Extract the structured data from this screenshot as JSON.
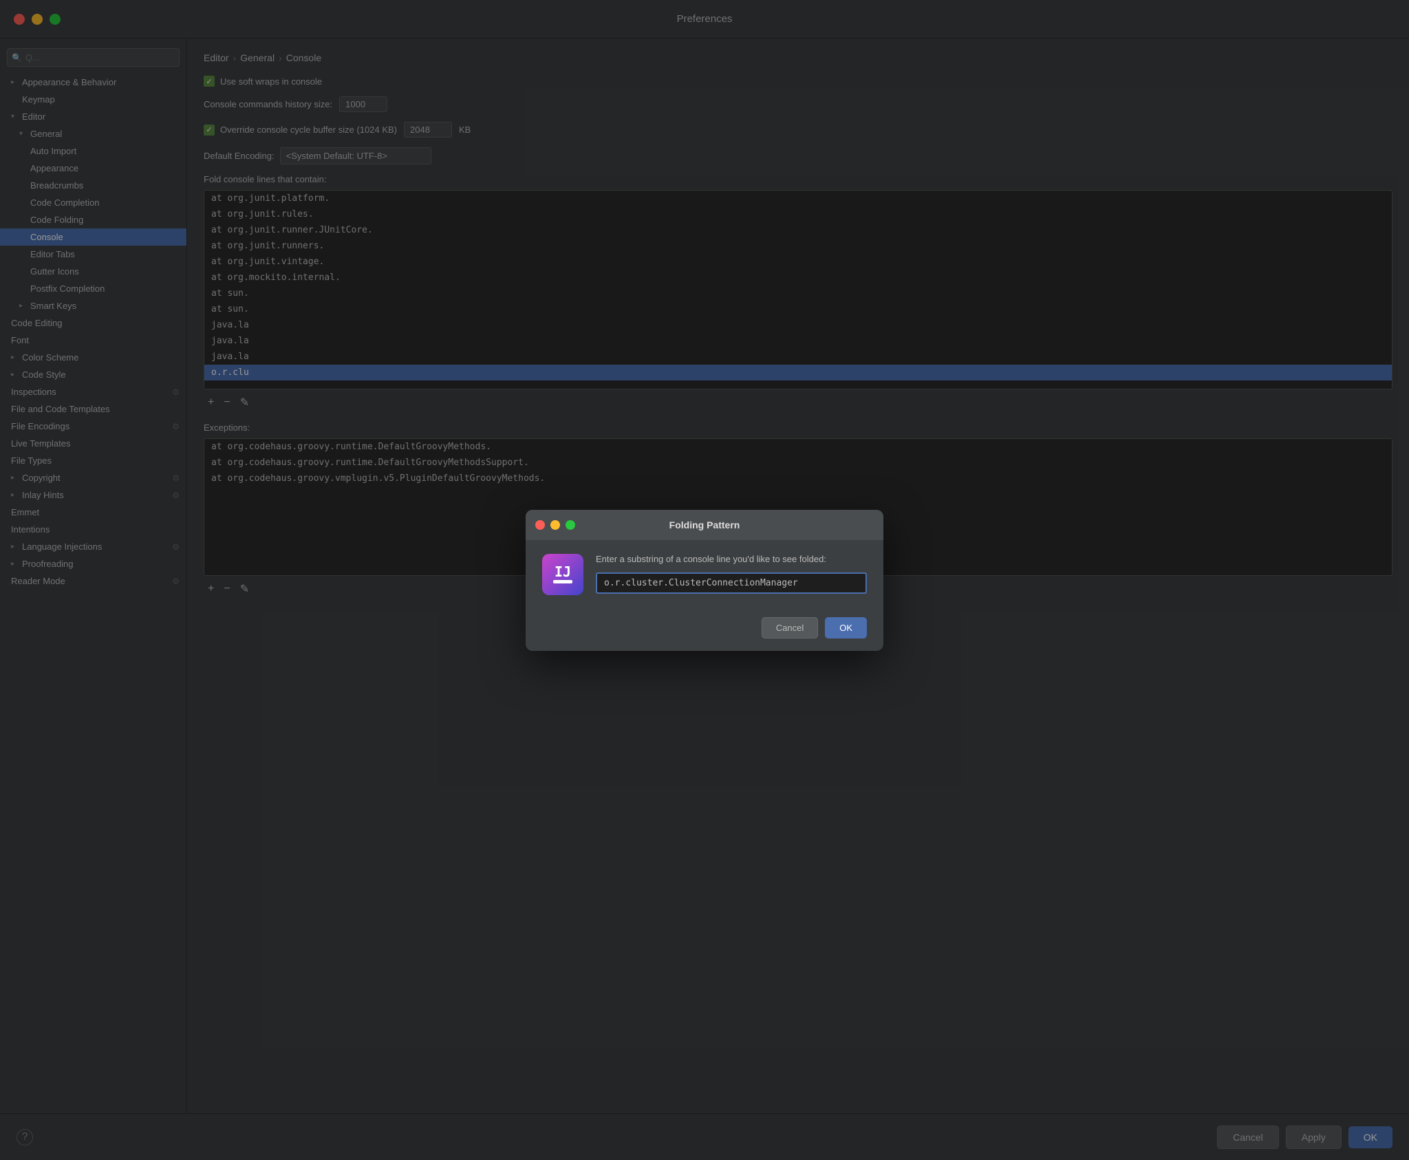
{
  "window": {
    "title": "Preferences"
  },
  "sidebar": {
    "search_placeholder": "Q...",
    "items": [
      {
        "id": "appearance-behavior",
        "label": "Appearance & Behavior",
        "indent": 0,
        "type": "collapsed-parent"
      },
      {
        "id": "keymap",
        "label": "Keymap",
        "indent": 0,
        "type": "item"
      },
      {
        "id": "editor",
        "label": "Editor",
        "indent": 0,
        "type": "expanded-parent"
      },
      {
        "id": "general",
        "label": "General",
        "indent": 1,
        "type": "expanded-parent"
      },
      {
        "id": "auto-import",
        "label": "Auto Import",
        "indent": 2,
        "type": "item"
      },
      {
        "id": "appearance",
        "label": "Appearance",
        "indent": 2,
        "type": "item"
      },
      {
        "id": "breadcrumbs",
        "label": "Breadcrumbs",
        "indent": 2,
        "type": "item"
      },
      {
        "id": "code-completion",
        "label": "Code Completion",
        "indent": 2,
        "type": "item"
      },
      {
        "id": "code-folding",
        "label": "Code Folding",
        "indent": 2,
        "type": "item"
      },
      {
        "id": "console",
        "label": "Console",
        "indent": 2,
        "type": "item",
        "active": true
      },
      {
        "id": "editor-tabs",
        "label": "Editor Tabs",
        "indent": 2,
        "type": "item"
      },
      {
        "id": "gutter-icons",
        "label": "Gutter Icons",
        "indent": 2,
        "type": "item"
      },
      {
        "id": "postfix-completion",
        "label": "Postfix Completion",
        "indent": 2,
        "type": "item"
      },
      {
        "id": "smart-keys",
        "label": "Smart Keys",
        "indent": 1,
        "type": "collapsed-parent"
      },
      {
        "id": "code-editing",
        "label": "Code Editing",
        "indent": 0,
        "type": "item"
      },
      {
        "id": "font",
        "label": "Font",
        "indent": 0,
        "type": "item"
      },
      {
        "id": "color-scheme",
        "label": "Color Scheme",
        "indent": 0,
        "type": "collapsed-parent"
      },
      {
        "id": "code-style",
        "label": "Code Style",
        "indent": 0,
        "type": "collapsed-parent"
      },
      {
        "id": "inspections",
        "label": "Inspections",
        "indent": 0,
        "type": "item",
        "has-icon": true
      },
      {
        "id": "file-code-templates",
        "label": "File and Code Templates",
        "indent": 0,
        "type": "item"
      },
      {
        "id": "file-encodings",
        "label": "File Encodings",
        "indent": 0,
        "type": "item",
        "has-icon": true
      },
      {
        "id": "live-templates",
        "label": "Live Templates",
        "indent": 0,
        "type": "item"
      },
      {
        "id": "file-types",
        "label": "File Types",
        "indent": 0,
        "type": "item"
      },
      {
        "id": "copyright",
        "label": "Copyright",
        "indent": 0,
        "type": "collapsed-parent",
        "has-icon": true
      },
      {
        "id": "inlay-hints",
        "label": "Inlay Hints",
        "indent": 0,
        "type": "collapsed-parent",
        "has-icon": true
      },
      {
        "id": "emmet",
        "label": "Emmet",
        "indent": 0,
        "type": "item"
      },
      {
        "id": "intentions",
        "label": "Intentions",
        "indent": 0,
        "type": "item"
      },
      {
        "id": "language-injections",
        "label": "Language Injections",
        "indent": 0,
        "type": "collapsed-parent",
        "has-icon": true
      },
      {
        "id": "proofreading",
        "label": "Proofreading",
        "indent": 0,
        "type": "collapsed-parent"
      },
      {
        "id": "reader-mode",
        "label": "Reader Mode",
        "indent": 0,
        "type": "item",
        "has-icon": true
      }
    ]
  },
  "breadcrumb": {
    "parts": [
      "Editor",
      "General",
      "Console"
    ]
  },
  "content": {
    "soft_wrap_label": "Use soft wraps in console",
    "history_size_label": "Console commands history size:",
    "history_size_value": "1000",
    "override_buffer_label": "Override console cycle buffer size (1024 KB)",
    "override_buffer_value": "2048",
    "override_buffer_unit": "KB",
    "encoding_label": "Default Encoding:",
    "encoding_value": "<System Default: UTF-8>",
    "fold_label": "Fold console lines that contain:",
    "fold_items": [
      "at org.junit.platform.",
      "at org.junit.rules.",
      "at org.junit.runner.JUnitCore.",
      "at org.junit.runners.",
      "at org.junit.vintage.",
      "at org.mockito.internal.",
      "at sun.",
      "at sun.",
      "java.la",
      "java.la",
      "java.la",
      "o.r.clu"
    ],
    "selected_fold_item": "o.r.clu",
    "exceptions_label": "Exceptions:",
    "exception_items": [
      "at org.codehaus.groovy.runtime.DefaultGroovyMethods.",
      "at org.codehaus.groovy.runtime.DefaultGroovyMethodsSupport.",
      "at org.codehaus.groovy.vmplugin.v5.PluginDefaultGroovyMethods."
    ]
  },
  "dialog": {
    "title": "Folding Pattern",
    "description": "Enter a substring of a console line you'd like to see folded:",
    "input_value": "o.r.cluster.ClusterConnectionManager",
    "cancel_label": "Cancel",
    "ok_label": "OK"
  },
  "bottom_bar": {
    "cancel_label": "Cancel",
    "apply_label": "Apply",
    "ok_label": "OK"
  }
}
